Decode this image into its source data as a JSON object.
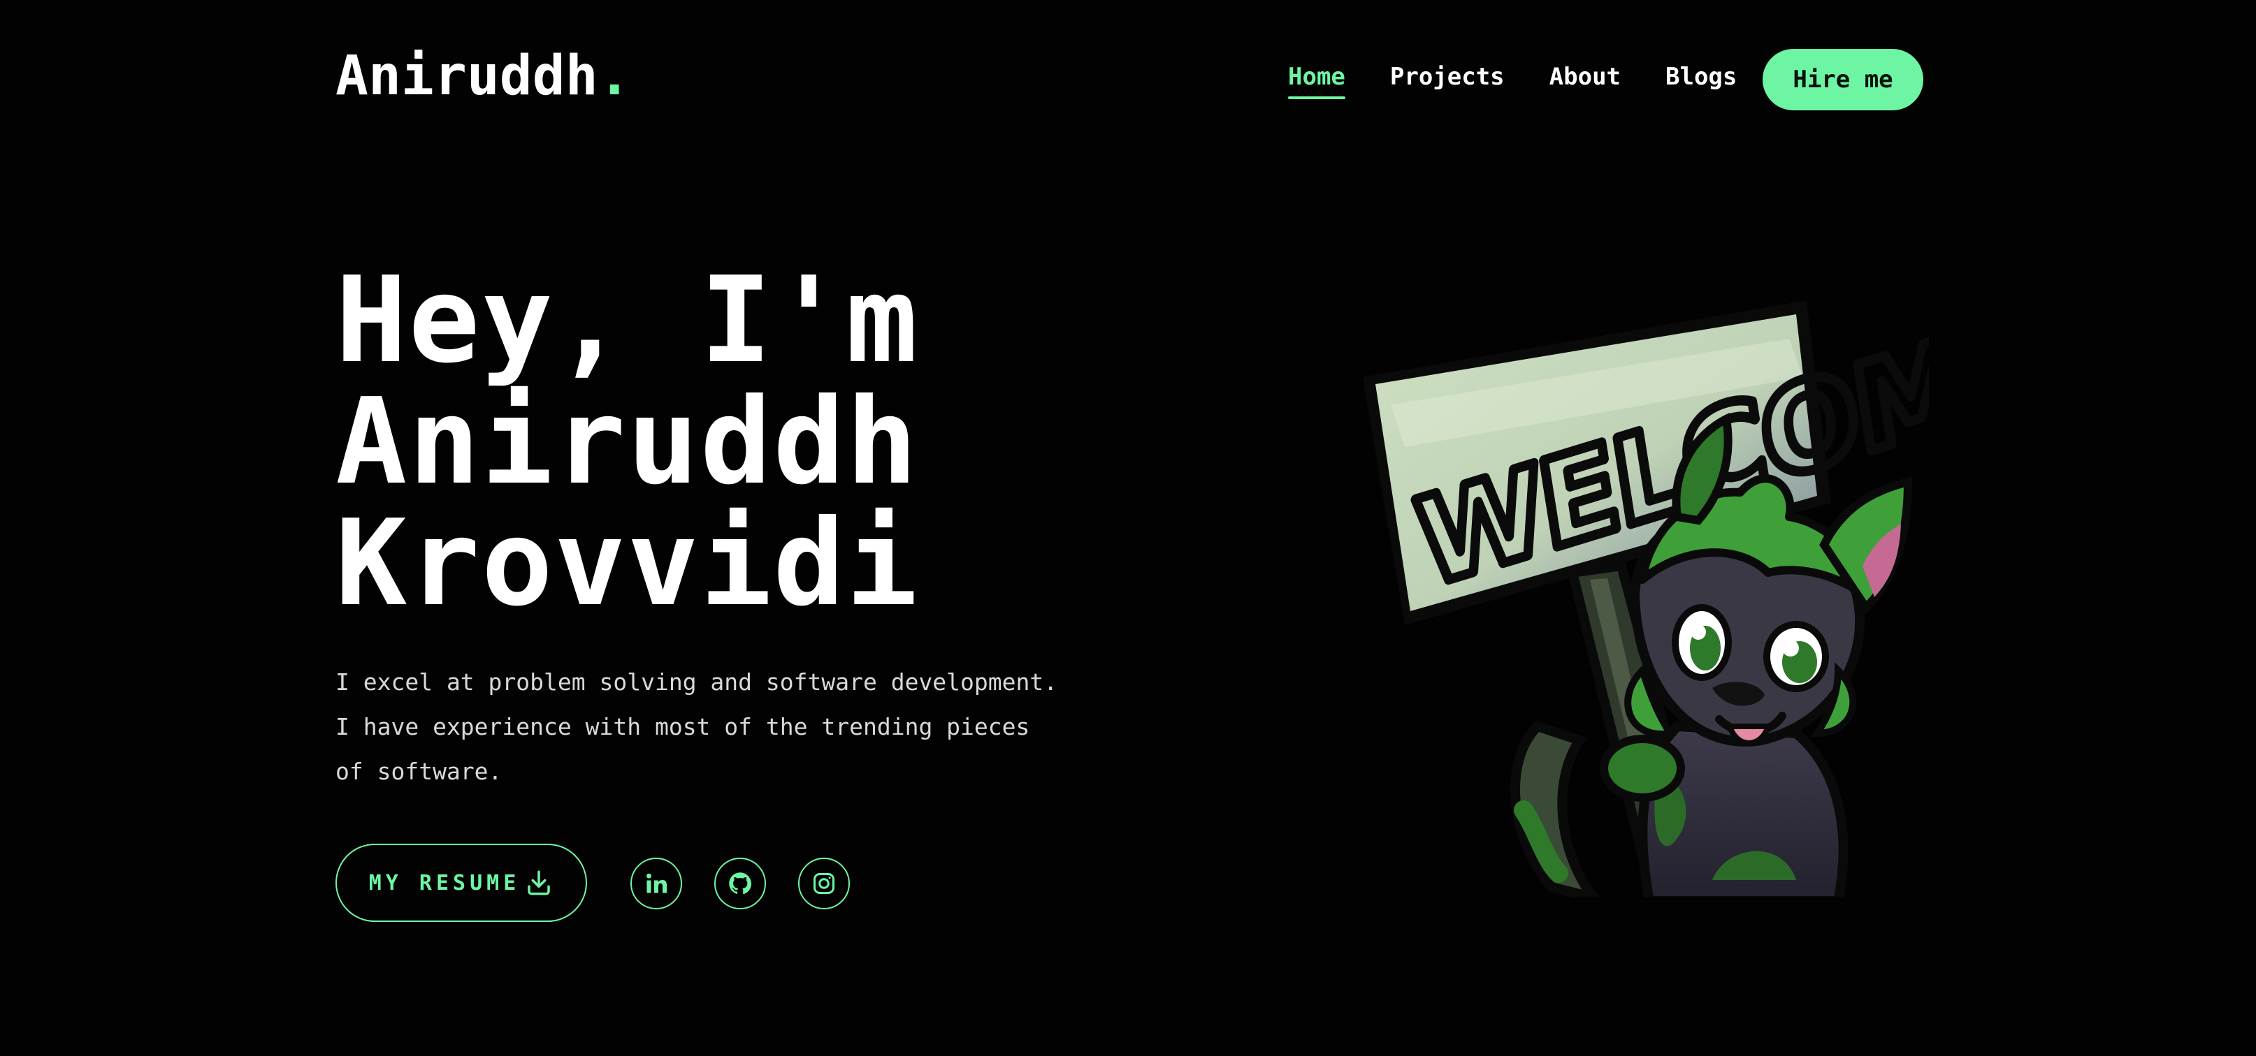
{
  "header": {
    "logo_text": "Aniruddh",
    "logo_dot": ".",
    "nav": [
      {
        "label": "Home",
        "active": true
      },
      {
        "label": "Projects",
        "active": false
      },
      {
        "label": "About",
        "active": false
      },
      {
        "label": "Blogs",
        "active": false
      }
    ],
    "hire_label": "Hire me"
  },
  "hero": {
    "title_lines": [
      "Hey, I'm",
      "Aniruddh",
      "Krovvidi"
    ],
    "description": "I excel at problem solving and software development. I have experience with most of the trending pieces of software.",
    "resume_label": "MY RESUME",
    "resume_icon": "download-icon",
    "socials": [
      {
        "name": "linkedin",
        "icon": "linkedin-icon"
      },
      {
        "name": "github",
        "icon": "github-icon"
      },
      {
        "name": "instagram",
        "icon": "instagram-icon"
      }
    ],
    "illustration_sign_text": "WELCOME"
  },
  "colors": {
    "background": "#020202",
    "accent": "#6ef5a4",
    "text": "#ffffff",
    "muted_text": "#d9d9d9"
  }
}
